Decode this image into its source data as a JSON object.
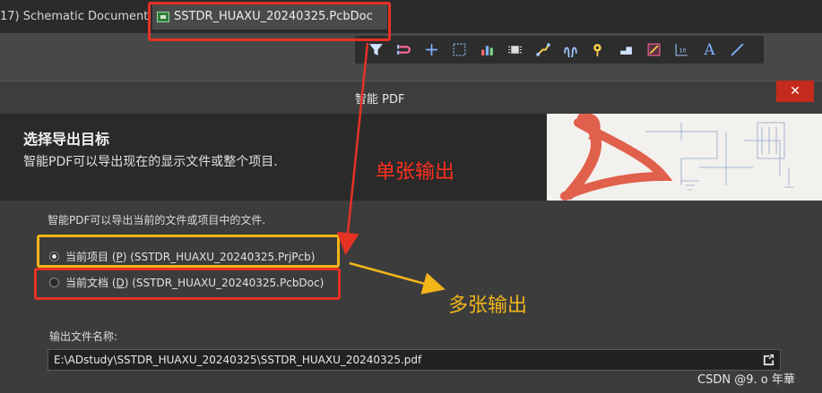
{
  "tabs": [
    {
      "label": "17) Schematic Document"
    },
    {
      "label": "SSTDR_HUAXU_20240325.PcbDoc"
    }
  ],
  "toolbar": {
    "icons": [
      "filter-icon",
      "route-icon",
      "plus-icon",
      "select-rect-icon",
      "chart-icon",
      "component-icon",
      "interactive-route-icon",
      "arc-route-icon",
      "via-icon",
      "fill-icon",
      "polygon-icon",
      "dimension-icon",
      "text-icon",
      "line-icon"
    ]
  },
  "dialog": {
    "title": "智能 PDF",
    "close": "✕",
    "heading": "选择导出目标",
    "subheading": "智能PDF可以导出现在的显示文件或整个项目.",
    "intro": "智能PDF可以导出当前的文件或项目中的文件.",
    "options": [
      {
        "prefix": "当前项目 (",
        "key": "P",
        "suffix": ") (SSTDR_HUAXU_20240325.PrjPcb)",
        "selected": true
      },
      {
        "prefix": "当前文档 (",
        "key": "D",
        "suffix": ") (SSTDR_HUAXU_20240325.PcbDoc)",
        "selected": false
      }
    ],
    "output_label": "输出文件名称:",
    "output_value": "E:\\ADstudy\\SSTDR_HUAXU_20240325\\SSTDR_HUAXU_20240325.pdf"
  },
  "annotations": {
    "single": "单张输出",
    "multi": "多张输出"
  },
  "watermark": "CSDN @9. o 年華",
  "colors": {
    "annotation_red": "#e53225",
    "annotation_yellow": "#f1b51a",
    "close_red": "#c42b1c"
  }
}
